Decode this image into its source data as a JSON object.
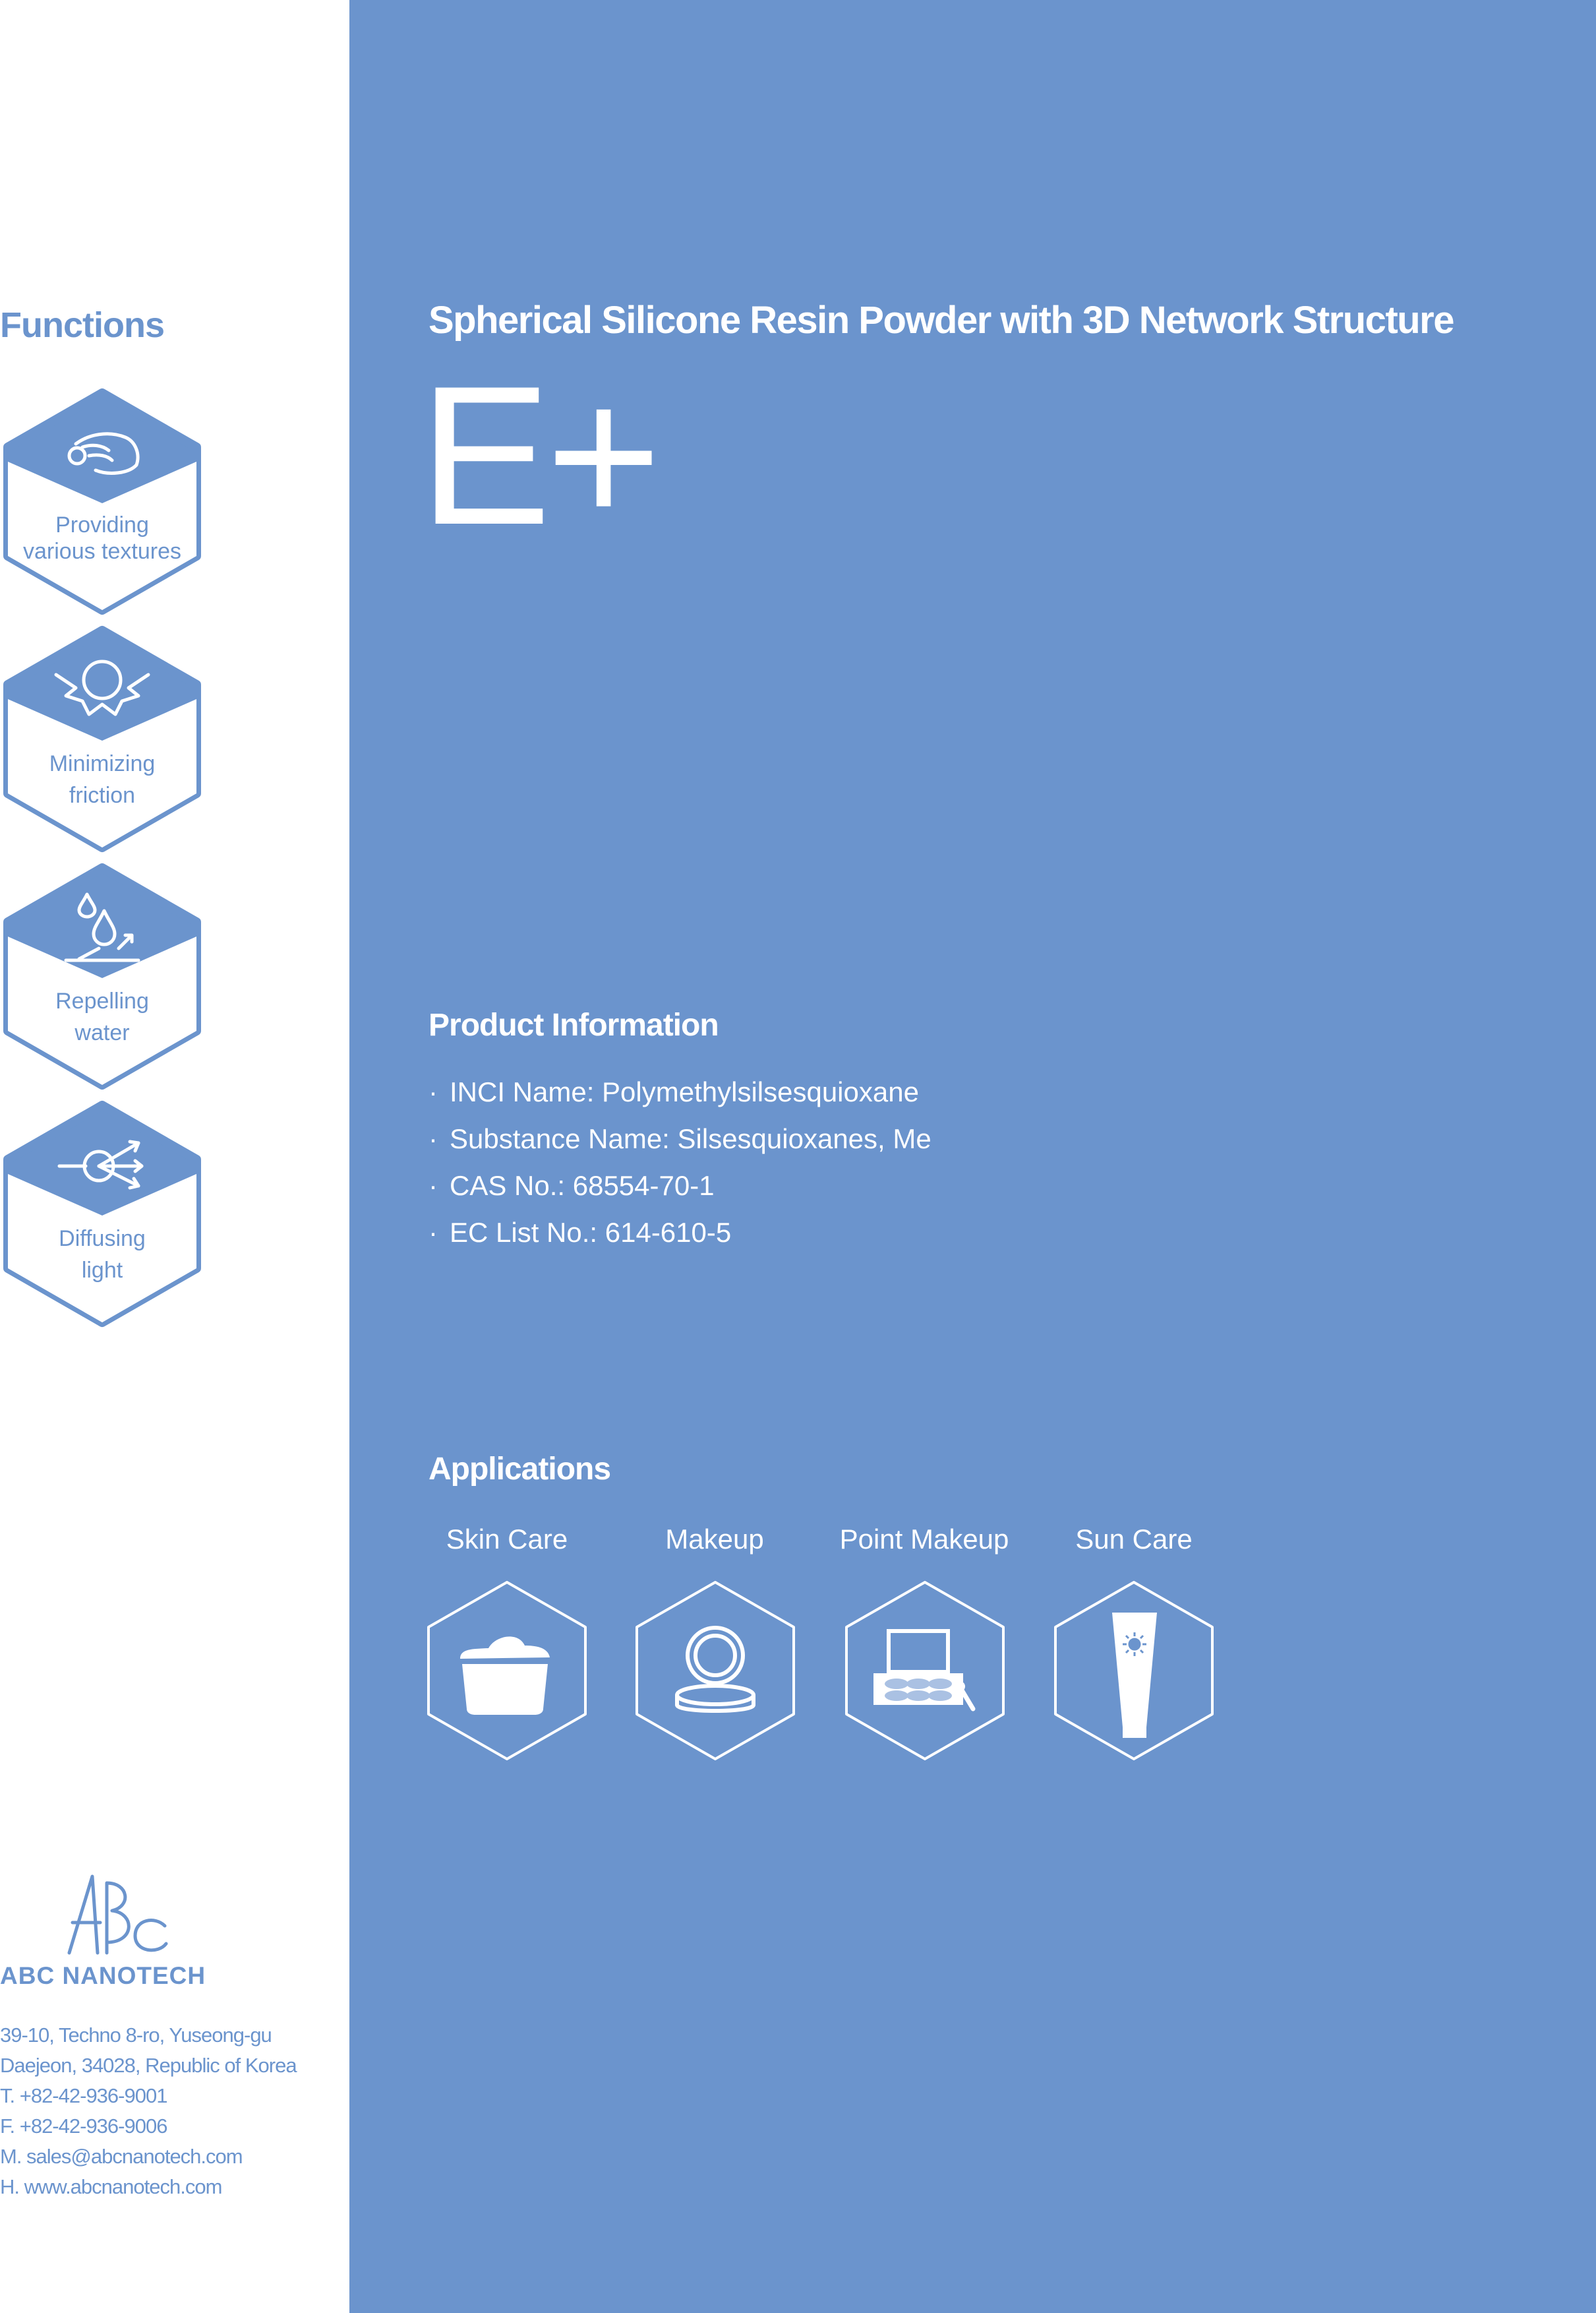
{
  "functions": {
    "title": "Functions",
    "items": [
      {
        "line1": "Providing",
        "line2": "various textures",
        "icon": "hand-pinch-icon"
      },
      {
        "line1": "Minimizing",
        "line2": "friction",
        "icon": "sun-friction-icon"
      },
      {
        "line1": "Repelling",
        "line2": "water",
        "icon": "water-drop-icon"
      },
      {
        "line1": "Diffusing",
        "line2": "light",
        "icon": "light-diffuse-icon"
      }
    ]
  },
  "product": {
    "subtitle": "Spherical Silicone Resin Powder with 3D Network Structure",
    "name": "E+"
  },
  "info": {
    "title": "Product Information",
    "bullet": "·",
    "items": [
      "INCI Name: Polymethylsilsesquioxane",
      "Substance Name: Silsesquioxanes, Me",
      "CAS No.: 68554-70-1",
      "EC List No.: 614-610-5"
    ]
  },
  "applications": {
    "title": "Applications",
    "items": [
      {
        "label": "Skin Care",
        "icon": "cream-jar-icon"
      },
      {
        "label": "Makeup",
        "icon": "compact-icon"
      },
      {
        "label": "Point Makeup",
        "icon": "eyeshadow-palette-icon"
      },
      {
        "label": "Sun Care",
        "icon": "sunscreen-tube-icon"
      }
    ]
  },
  "company": {
    "logo_letters": "ABC",
    "name": "ABC NANOTECH",
    "address1": "39-10, Techno 8-ro, Yuseong-gu",
    "address2": "Daejeon, 34028, Republic of Korea",
    "phone": "T. +82-42-936-9001",
    "fax": "F. +82-42-936-9006",
    "mail": "M. sales@abcnanotech.com",
    "web": "H. www.abcnanotech.com"
  },
  "colors": {
    "accent": "#6b94cd",
    "background": "#ffffff",
    "text_on_accent": "#ffffff"
  }
}
